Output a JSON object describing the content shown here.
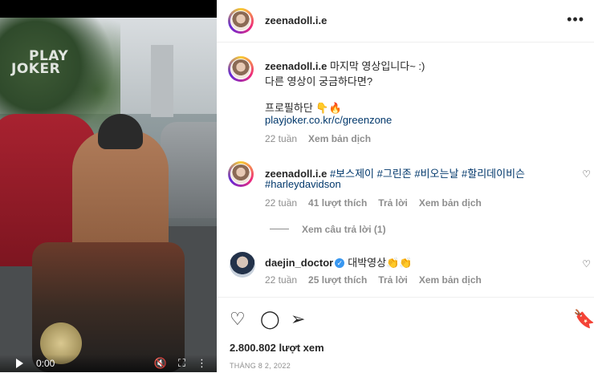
{
  "video": {
    "watermark_line1": "PLAY",
    "watermark_line2": "JOKER",
    "time": "0:00",
    "icons": [
      "play-icon",
      "mute-icon",
      "fullscreen-icon",
      "more-options-icon"
    ]
  },
  "post": {
    "author": "zeenadoll.i.e",
    "more_icon": "•••"
  },
  "caption": {
    "author": "zeenadoll.i.e",
    "line1": "마지막 영상입니다~ :)",
    "line2": "다른 영상이 궁금하다면?",
    "line3": "프로필하단 👇🔥",
    "link": "playjoker.co.kr/c/greenzone",
    "age": "22 tuần",
    "translate": "Xem bản dịch"
  },
  "comments": [
    {
      "author": "zeenadoll.i.e",
      "tags_line1": "#보스제이 #그린존 #비오는날 #할리데이비슨",
      "tags_line2": "#harleydavidson",
      "age": "22 tuần",
      "likes": "41 lượt thích",
      "reply": "Trả lời",
      "translate": "Xem bản dịch",
      "view_replies": "Xem câu trả lời (1)"
    },
    {
      "author": "daejin_doctor",
      "verified": "✓",
      "text": "대박영상👏👏",
      "age": "22 tuần",
      "likes": "25 lượt thích",
      "reply": "Trả lời",
      "translate": "Xem bản dịch"
    }
  ],
  "stats": {
    "views": "2.800.802 lượt xem",
    "date": "THÁNG 8 2, 2022"
  },
  "colors": {
    "tag": "#00376b",
    "muted": "#8e8e8e",
    "verified": "#3897f0"
  }
}
